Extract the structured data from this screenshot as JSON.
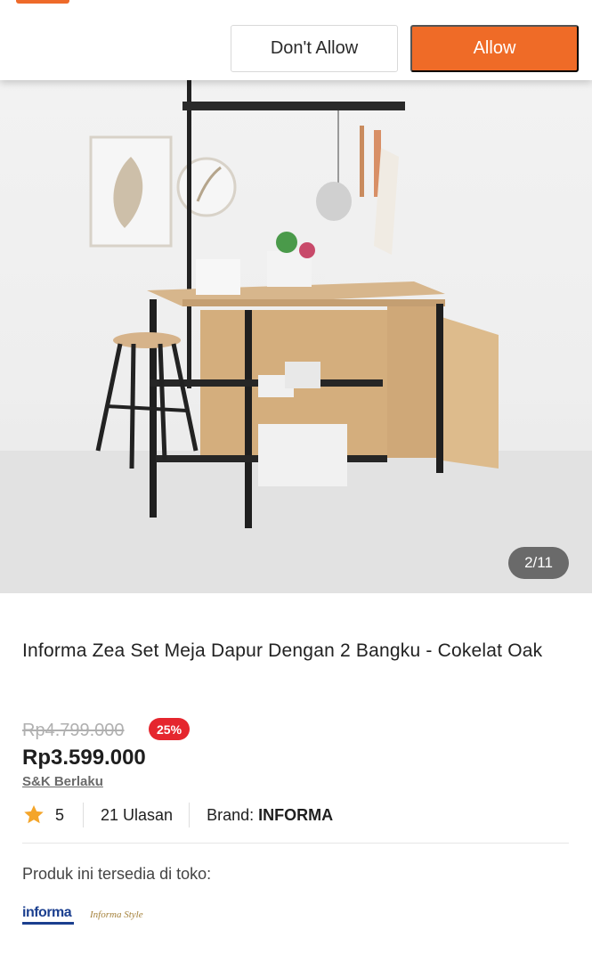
{
  "permission": {
    "deny_label": "Don't Allow",
    "allow_label": "Allow"
  },
  "gallery": {
    "counter": "2/11"
  },
  "product": {
    "title": "Informa Zea Set Meja Dapur Dengan 2 Bangku - Cokelat Oak",
    "original_price": "Rp4.799.000",
    "discount": "25%",
    "price": "Rp3.599.000",
    "terms_link": "S&K Berlaku",
    "rating": "5",
    "reviews": "21 Ulasan",
    "brand_label": "Brand:",
    "brand_name": "INFORMA"
  },
  "availability": {
    "label": "Produk ini tersedia di toko:",
    "stores": [
      "informa",
      "Informa Style"
    ]
  },
  "colors": {
    "accent": "#ef6b27",
    "discount": "#e5262e",
    "star": "#f4a52a"
  }
}
